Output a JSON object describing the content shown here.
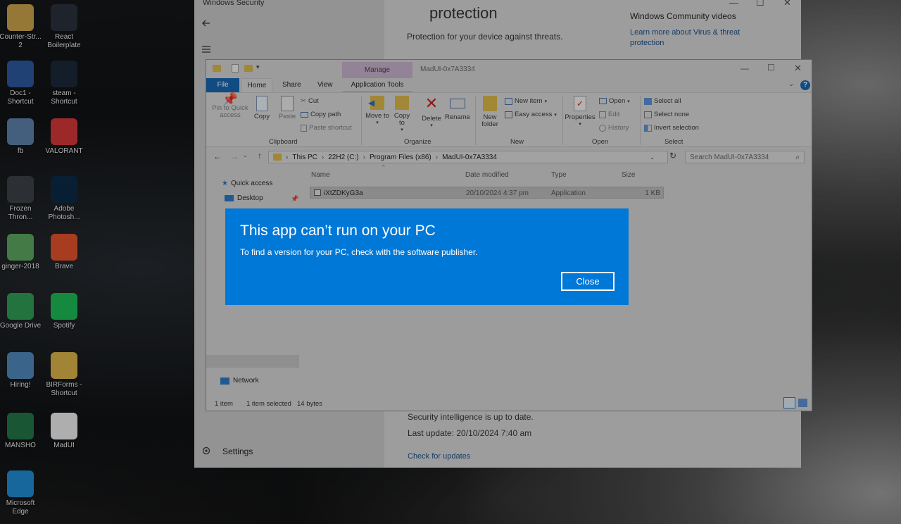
{
  "desktop": {
    "icons": [
      {
        "label": "Counter-Str... 2",
        "icon": "counter-strike-icon",
        "color": "#c7a14a"
      },
      {
        "label": "React Boilerplate",
        "icon": "react-icon",
        "color": "#2a2f3a"
      },
      {
        "label": "Doc1 - Shortcut",
        "icon": "word-icon",
        "color": "#2b579a"
      },
      {
        "label": "steam - Shortcut",
        "icon": "steam-icon",
        "color": "#1b2838"
      },
      {
        "label": "fb",
        "icon": "document-thumbnail-icon",
        "color": "#5b7fa8"
      },
      {
        "label": "VALORANT",
        "icon": "valorant-icon",
        "color": "#d13639"
      },
      {
        "label": "Frozen Thron...",
        "icon": "frozen-throne-icon",
        "color": "#3b3f46"
      },
      {
        "label": "Adobe Photosh...",
        "icon": "photoshop-icon",
        "color": "#0b2a45"
      },
      {
        "label": "ginger-2018",
        "icon": "ginger-icon",
        "color": "#5aa35c"
      },
      {
        "label": "Brave",
        "icon": "brave-icon",
        "color": "#e0512c"
      },
      {
        "label": "Google Drive",
        "icon": "google-drive-icon",
        "color": "#2e9a52"
      },
      {
        "label": "Spotify",
        "icon": "spotify-icon",
        "color": "#1db954"
      },
      {
        "label": "Hiring!",
        "icon": "document-thumbnail-icon",
        "color": "#4f86b8"
      },
      {
        "label": "BIRForms - Shortcut",
        "icon": "birforms-seal-icon",
        "color": "#d8b04a"
      },
      {
        "label": "MANSHO",
        "icon": "excel-icon",
        "color": "#217346"
      },
      {
        "label": "MadUI",
        "icon": "blank-file-icon",
        "color": "#e8e8e8"
      },
      {
        "label": "Microsoft Edge",
        "icon": "edge-icon",
        "color": "#1f8ad1"
      }
    ]
  },
  "windows_security": {
    "title": "Windows Security",
    "heading": "protection",
    "subheading": "Protection for your device against threats.",
    "community_title": "Windows Community videos",
    "community_link": "Learn more about Virus & threat protection",
    "intel_status": "Security intelligence is up to date.",
    "last_update": "Last update: 20/10/2024 7:40 am",
    "check_updates": "Check for updates",
    "settings": "Settings"
  },
  "explorer": {
    "title": "MadUI-0x7A3334",
    "context_tab": "Manage",
    "tabs": [
      "File",
      "Home",
      "Share",
      "View",
      "Application Tools"
    ],
    "ribbon": {
      "pin": "Pin to Quick access",
      "copy": "Copy",
      "paste": "Paste",
      "cut": "Cut",
      "copy_path": "Copy path",
      "paste_shortcut": "Paste shortcut",
      "move_to": "Move to",
      "copy_to": "Copy to",
      "delete": "Delete",
      "rename": "Rename",
      "new_folder": "New folder",
      "new_item": "New item",
      "easy_access": "Easy access",
      "properties": "Properties",
      "open": "Open",
      "edit": "Edit",
      "history": "History",
      "select_all": "Select all",
      "select_none": "Select none",
      "invert_selection": "Invert selection",
      "groups": [
        "Clipboard",
        "Organize",
        "New",
        "Open",
        "Select"
      ]
    },
    "breadcrumb": [
      "This PC",
      "22H2 (C:)",
      "Program Files (x86)",
      "MadUI-0x7A3334"
    ],
    "search_placeholder": "Search MadUI-0x7A3334",
    "nav": {
      "quick_access": "Quick access",
      "desktop": "Desktop",
      "network": "Network"
    },
    "columns": [
      "Name",
      "Date modified",
      "Type",
      "Size"
    ],
    "files": [
      {
        "name": "iXtZDKyG3a",
        "date": "20/10/2024 4:37 pm",
        "type": "Application",
        "size": "1 KB"
      }
    ],
    "status": {
      "count": "1 item",
      "selected": "1 item selected",
      "bytes": "14 bytes"
    }
  },
  "dialog": {
    "title": "This app can’t run on your PC",
    "message": "To find a version for your PC, check with the software publisher.",
    "close_label": "Close",
    "accent": "#0078d7"
  }
}
